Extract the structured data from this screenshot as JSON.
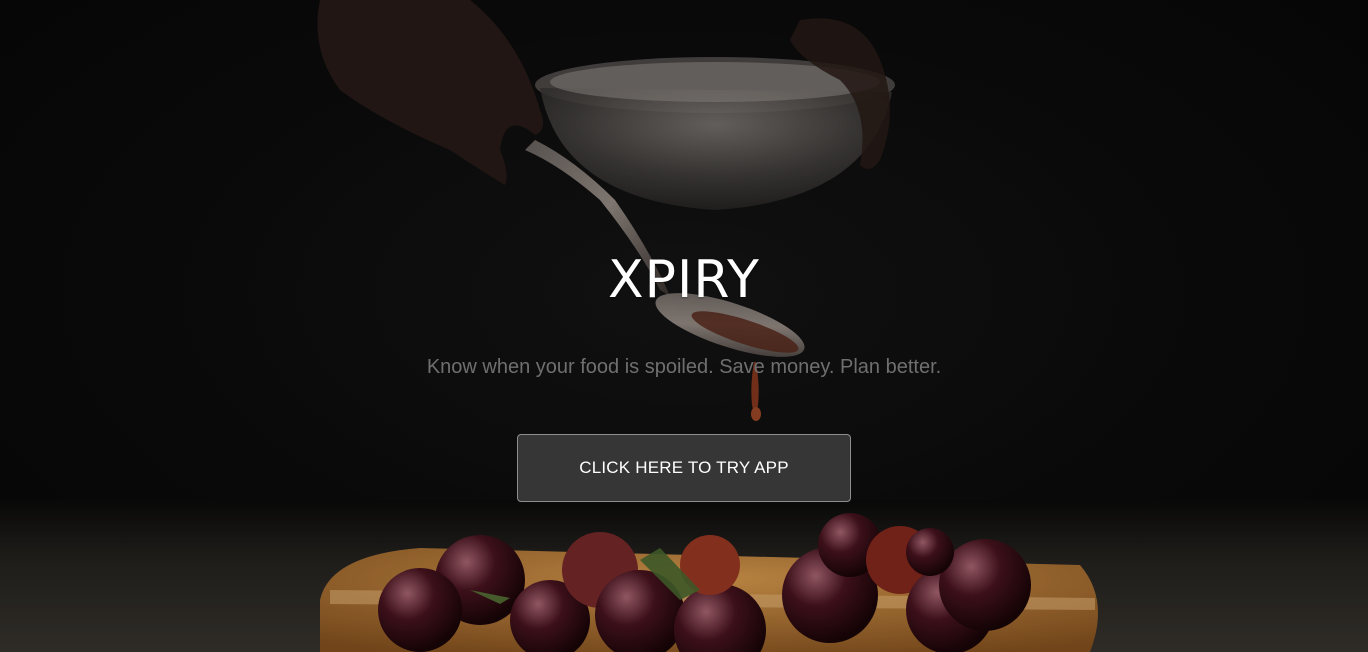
{
  "hero": {
    "title": "XPIRY",
    "tagline": "Know when your food is spoiled. Save money. Plan better.",
    "cta_label": "CLICK HERE TO TRY APP"
  },
  "colors": {
    "background": "#0b0b0b",
    "title": "#ffffff",
    "tagline": "#6f6f6f",
    "button_bg": "#464646",
    "button_border": "#8e8e8e"
  }
}
